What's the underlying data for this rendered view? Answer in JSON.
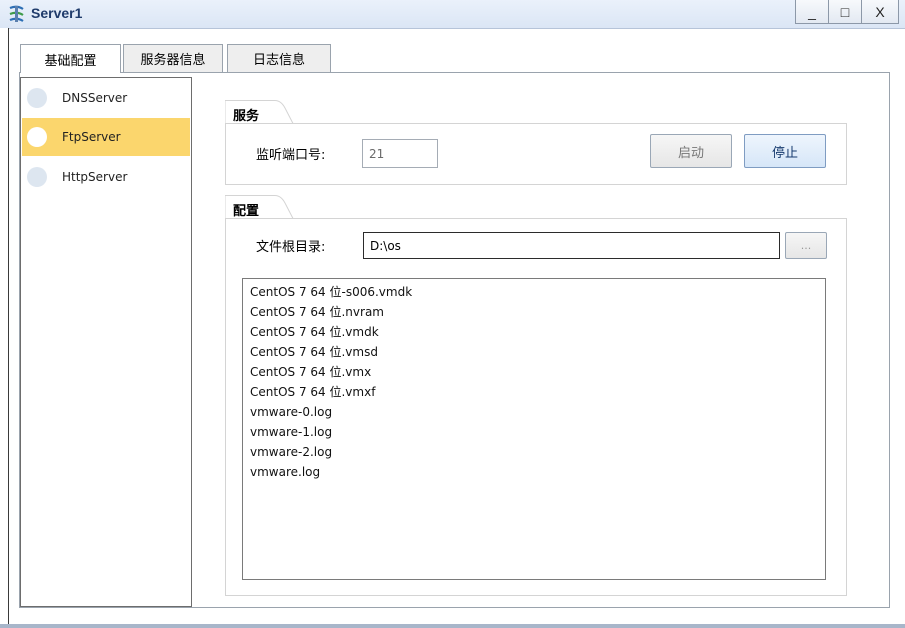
{
  "window": {
    "title": "Server1",
    "minimize": "_",
    "maximize": "□",
    "close": "X"
  },
  "tabs": [
    {
      "label": "基础配置"
    },
    {
      "label": "服务器信息"
    },
    {
      "label": "日志信息"
    }
  ],
  "servers": [
    {
      "label": "DNSServer",
      "selected": false
    },
    {
      "label": "FtpServer",
      "selected": true
    },
    {
      "label": "HttpServer",
      "selected": false
    }
  ],
  "service_group": {
    "title": "服务",
    "port_label": "监听端口号:",
    "port_value": "21",
    "start_label": "启动",
    "stop_label": "停止"
  },
  "config_group": {
    "title": "配置",
    "root_label": "文件根目录:",
    "root_value": "D:\\os",
    "browse_label": "..."
  },
  "files": [
    "CentOS 7 64 位-s006.vmdk",
    "CentOS 7 64 位.nvram",
    "CentOS 7 64 位.vmdk",
    "CentOS 7 64 位.vmsd",
    "CentOS 7 64 位.vmx",
    "CentOS 7 64 位.vmxf",
    "vmware-0.log",
    "vmware-1.log",
    "vmware-2.log",
    "vmware.log"
  ],
  "colors": {
    "selected_item": "#fbd66d",
    "title_text": "#1f3b6b"
  }
}
